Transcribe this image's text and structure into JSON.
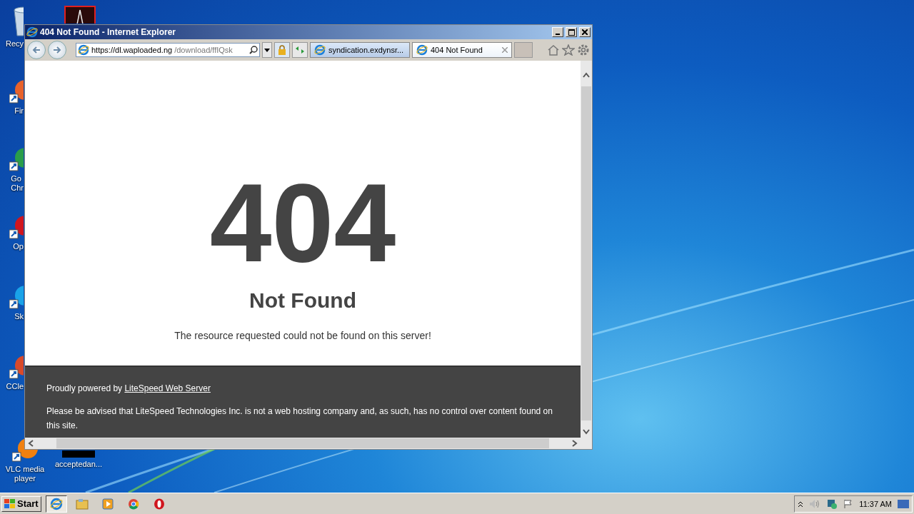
{
  "desktop": {
    "icons": [
      {
        "kind": "recycle",
        "label": "Recy"
      },
      {
        "kind": "pdf"
      },
      {
        "kind": "firefox",
        "label": "Fir"
      },
      {
        "kind": "chrome",
        "label": "Go Chr"
      },
      {
        "kind": "opera",
        "label": "Op"
      },
      {
        "kind": "skype",
        "label": "Sk"
      },
      {
        "kind": "ccleaner",
        "label": "CCle"
      },
      {
        "kind": "vlc",
        "label": "VLC media player"
      },
      {
        "kind": "file",
        "label": "acceptedan..."
      }
    ]
  },
  "window": {
    "title": "404 Not Found - Internet Explorer",
    "address": {
      "host": "https://dl.waploaded.ng",
      "path": "/download/ffIQsk"
    },
    "tabs": [
      {
        "label": "syndication.exdynsr...",
        "selected": false
      },
      {
        "label": "404 Not Found",
        "selected": true
      }
    ],
    "page": {
      "code": "404",
      "heading": "Not Found",
      "message": "The resource requested could not be found on this server!",
      "footer": {
        "powered_by": "Proudly powered by",
        "link": "LiteSpeed Web Server",
        "notice": "Please be advised that LiteSpeed Technologies Inc. is not a web hosting company and, as such, has no control over content found on this site."
      }
    }
  },
  "taskbar": {
    "start": "Start",
    "apps": [
      {
        "kind": "ie",
        "selected": true
      },
      {
        "kind": "explorer",
        "selected": false
      },
      {
        "kind": "media",
        "selected": false
      },
      {
        "kind": "chrome",
        "selected": false
      },
      {
        "kind": "opera",
        "selected": false
      }
    ],
    "clock": "11:37 AM"
  }
}
